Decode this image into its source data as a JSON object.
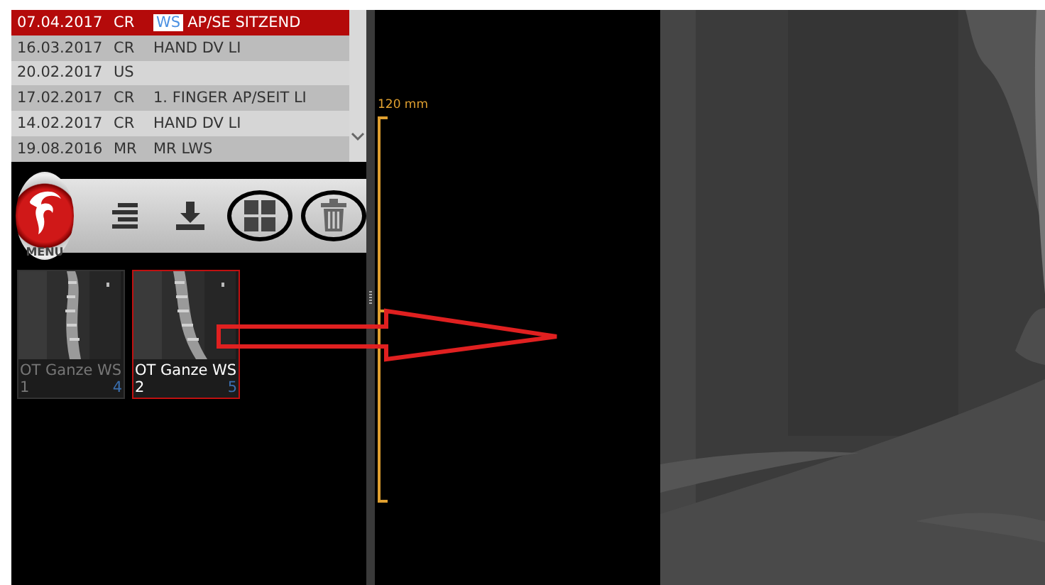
{
  "studies": [
    {
      "date": "07.04.2017",
      "modality": "CR",
      "marked_text": "WS",
      "description": "AP/SE SITZEND",
      "selected": true
    },
    {
      "date": "16.03.2017",
      "modality": "CR",
      "description": "HAND DV LI",
      "selected": false
    },
    {
      "date": "20.02.2017",
      "modality": "US",
      "selected": false
    },
    {
      "date": "17.02.2017",
      "modality": "CR",
      "description": "1. FINGER AP/SEIT LI",
      "selected": false
    },
    {
      "date": "14.02.2017",
      "modality": "CR",
      "description": "HAND DV LI",
      "selected": false
    },
    {
      "date": "19.08.2016",
      "modality": "MR",
      "description": "MR LWS",
      "selected": false
    }
  ],
  "toolbar": {
    "menu_label": "MENU",
    "tools": [
      {
        "kind": "list",
        "circled": false
      },
      {
        "kind": "download",
        "circled": false
      },
      {
        "kind": "layout",
        "circled": true
      },
      {
        "kind": "trash",
        "circled": true
      }
    ]
  },
  "series": [
    {
      "title": "OT Ganze WS",
      "number": "1",
      "count": "4",
      "selected": false
    },
    {
      "title": "OT Ganze WS",
      "number": "2",
      "count": "5",
      "selected": true
    }
  ],
  "ruler": {
    "label": "120 mm"
  }
}
